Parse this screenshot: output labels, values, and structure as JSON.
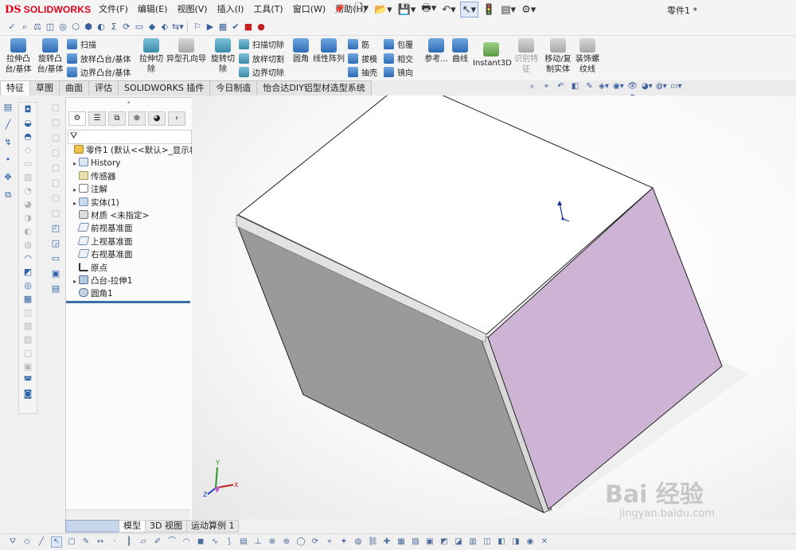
{
  "app": {
    "logo_ds": "DS",
    "logo_name": "SOLIDWORKS",
    "menus": [
      "文件(F)",
      "编辑(E)",
      "视图(V)",
      "插入(I)",
      "工具(T)",
      "窗口(W)",
      "帮助(H)"
    ],
    "document_title": "零件1 *"
  },
  "command_manager": {
    "extrude_boss": "拉伸凸\n台/基体",
    "revolve_boss": "旋转凸\n台/基体",
    "sweep": "扫描",
    "loft": "放样凸台/基体",
    "boundary_boss": "边界凸台/基体",
    "extrude_cut": "拉伸切\n除",
    "hole_wizard": "异型孔向导",
    "revolve_cut": "旋转切\n除",
    "swept_cut": "扫描切除",
    "lofted_cut": "放样切割",
    "boundary_cut": "边界切除",
    "fillet": "圆角",
    "linear_pattern": "线性阵列",
    "rib": "筋",
    "draft": "拔模",
    "shell": "抽壳",
    "wrap": "包覆",
    "intersect": "相交",
    "mirror": "镜向",
    "reference": "参考...",
    "curves": "曲线",
    "instant3d": "Instant3D",
    "feature_recognition": "识别特\n征",
    "move_copy": "移动/复\n制实体",
    "cosmetic_thread": "装饰螺\n纹线"
  },
  "tabs": [
    "特征",
    "草图",
    "曲面",
    "评估",
    "SOLIDWORKS 插件",
    "今日制造",
    "怡合达DIY铝型材选型系统"
  ],
  "feature_tree": {
    "root": "零件1  (默认<<默认>_显示状态",
    "items": [
      {
        "label": "History",
        "icon": "history-icon",
        "expand": true
      },
      {
        "label": "传感器",
        "icon": "sensor-icon",
        "expand": false
      },
      {
        "label": "注解",
        "icon": "annotation-icon",
        "expand": true
      },
      {
        "label": "实体(1)",
        "icon": "solid-body-icon",
        "expand": true
      },
      {
        "label": "材质 <未指定>",
        "icon": "material-icon",
        "expand": false
      },
      {
        "label": "前视基准面",
        "icon": "plane-icon",
        "expand": false
      },
      {
        "label": "上视基准面",
        "icon": "plane-icon",
        "expand": false
      },
      {
        "label": "右视基准面",
        "icon": "plane-icon",
        "expand": false
      },
      {
        "label": "原点",
        "icon": "origin-icon",
        "expand": false
      },
      {
        "label": "凸台-拉伸1",
        "icon": "boss-extrude-icon",
        "expand": true
      },
      {
        "label": "圆角1",
        "icon": "fillet-icon",
        "expand": false
      }
    ]
  },
  "triad": {
    "x": "X",
    "y": "Y",
    "z": "Z"
  },
  "bottom_tabs": [
    "模型",
    "3D 视图",
    "运动算例 1"
  ],
  "watermark": {
    "main": "Bai 经验",
    "sub": "jingyan.baidu.com"
  },
  "colors": {
    "brand": "#e2001a",
    "face_top": "#ffffff",
    "face_left": "#9a9a9a",
    "face_right": "#cdb3d4",
    "rollback_bar": "#3b6ea5"
  }
}
